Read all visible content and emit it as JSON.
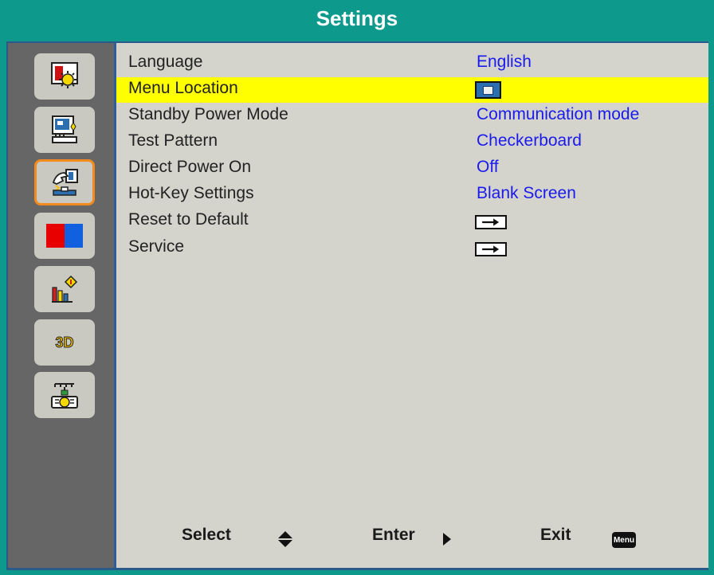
{
  "header": {
    "title": "Settings"
  },
  "sidebar": {
    "items": [
      {
        "icon": "picture-icon"
      },
      {
        "icon": "screen-icon"
      },
      {
        "icon": "settings-hand-icon",
        "active": true
      },
      {
        "icon": "color-icon"
      },
      {
        "icon": "information-icon"
      },
      {
        "icon": "3d-icon",
        "text": "3D"
      },
      {
        "icon": "network-icon"
      }
    ]
  },
  "menu": {
    "rows": [
      {
        "label": "Language",
        "value": "English"
      },
      {
        "label": "Menu Location",
        "value_icon": "menu-location-icon"
      },
      {
        "label": "Standby Power Mode",
        "value": "Communication mode"
      },
      {
        "label": "Test Pattern",
        "value": "Checkerboard"
      },
      {
        "label": "Direct Power On",
        "value": "Off"
      },
      {
        "label": "Hot-Key Settings",
        "value": "Blank Screen"
      },
      {
        "label": "Reset to Default",
        "value_icon": "enter-arrow-icon"
      },
      {
        "label": "Service",
        "value_icon": "enter-arrow-icon"
      }
    ]
  },
  "footer": {
    "select": "Select",
    "enter": "Enter",
    "exit": "Exit",
    "menu_badge": "Menu",
    "icons": [
      "up-down-arrows-icon",
      "right-arrow-icon",
      "menu-key-icon"
    ]
  },
  "colors": {
    "frame": "#0d9a8c",
    "sidebar": "#666666",
    "content": "#d4d4cc",
    "highlight": "#ffff00",
    "value_text": "#1a1aee",
    "active_border": "#f28a1e"
  }
}
